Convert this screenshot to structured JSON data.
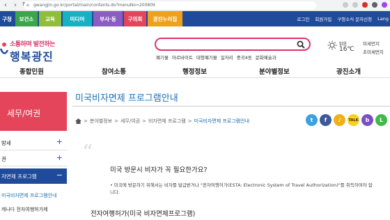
{
  "browser": {
    "url": "gwangjin.go.kr/portal/main/contents.do?menuNo=200809"
  },
  "top_tabs": [
    {
      "label": "구청",
      "color": "#1f4b9a"
    },
    {
      "label": "보건소",
      "color": "#3aa54a"
    },
    {
      "label": "교육",
      "color": "#8fbf3a"
    },
    {
      "label": "미디어",
      "color": "#17b1c4"
    },
    {
      "label": "부사·동",
      "color": "#8b5dc2"
    },
    {
      "label": "구의회",
      "color": "#e4455a"
    },
    {
      "label": "광진누리집",
      "color": "#f0a11a"
    }
  ],
  "top_links": [
    "로그인",
    "회원가입",
    "구청소식 문자신청",
    "Lang"
  ],
  "logo": {
    "tagline": "소통하며 발전하는",
    "name": "행복광진"
  },
  "search": {
    "placeholder": ""
  },
  "keywords": [
    "폐기물",
    "아르바이트",
    "대형폐기물",
    "일자리",
    "중곡4동",
    "문화예술과"
  ],
  "weather": {
    "condition": "맑음",
    "temp": "16℃"
  },
  "dust": {
    "fine": "미세먼지",
    "ultrafine": "초미세먼지"
  },
  "main_nav": [
    "종합민원",
    "참여소통",
    "행정정보",
    "분야별정보",
    "광진소개"
  ],
  "sidebar": {
    "title": "세무/여권",
    "items": [
      {
        "label": "방세",
        "toggle": "+"
      },
      {
        "label": "권",
        "toggle": "+"
      },
      {
        "label": "자면제 프로그램",
        "toggle": "−"
      }
    ],
    "subitems": [
      "미국비자면제 프로그램안내",
      "캐나다 전자여행허가제"
    ]
  },
  "content": {
    "title": "미국비자면제 프로그램안내",
    "breadcrumb": [
      "분야별정보",
      "세무/여권",
      "비자면제 프로그램",
      "미국비자면제 프로그램안내"
    ],
    "quote_mark": "“",
    "heading": "미국 방문시 비자가 꼭 필요한가요?",
    "body": "• 미국에 방문하기 위해서는 비자를 발급받거나 \"전자여행허가(ESTA: Electronic System of Travel Authorization)\"를 취득하여야 합니다.",
    "subheading": "전자여행허가(미국 비자면제프로그램)"
  },
  "share": [
    {
      "name": "twitter",
      "label": "t",
      "color": "#3aa1e0"
    },
    {
      "name": "facebook",
      "label": "f",
      "color": "#3b5998"
    },
    {
      "name": "kakaostory",
      "label": "♪",
      "color": "#f0b01a"
    },
    {
      "name": "kakaotalk",
      "label": "TALK",
      "color": "#f7d31b"
    },
    {
      "name": "band",
      "label": "b",
      "color": "#7a4fc4"
    },
    {
      "name": "line",
      "label": "L",
      "color": "#3fb94a"
    }
  ]
}
